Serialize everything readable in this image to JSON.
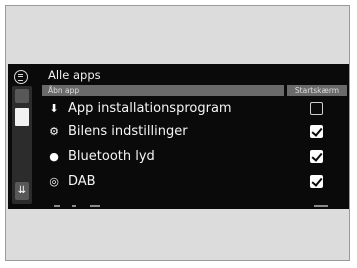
{
  "header": {
    "title": "Alle apps"
  },
  "columns": {
    "app": "Åbn app",
    "start": "Startskærm"
  },
  "rows": [
    {
      "label": "App installationsprogram",
      "icon": "app-installer-icon",
      "checked": false
    },
    {
      "label": "Bilens indstillinger",
      "icon": "car-settings-icon",
      "checked": true
    },
    {
      "label": "Bluetooth lyd",
      "icon": "bluetooth-icon",
      "checked": true
    },
    {
      "label": "DAB",
      "icon": "dab-radio-icon",
      "checked": true
    }
  ],
  "scroll": {
    "position": 0.0
  },
  "colors": {
    "background": "#0a0a0a",
    "header_bar": "#6a6a6a",
    "text": "#f5f5f5"
  }
}
